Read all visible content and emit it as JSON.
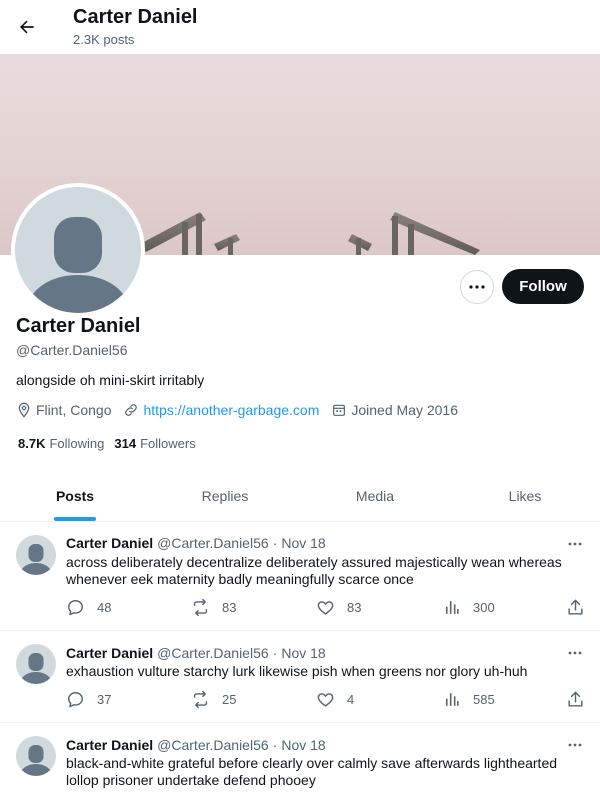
{
  "header": {
    "title": "Carter Daniel",
    "post_count": "2.3K posts"
  },
  "profile": {
    "name": "Carter Daniel",
    "handle": "@Carter.Daniel56",
    "bio": "alongside oh mini-skirt irritably",
    "location": "Flint, Congo",
    "website": "https://another-garbage.com",
    "joined": "Joined May 2016",
    "following_count": "8.7K",
    "following_label": "Following",
    "followers_count": "314",
    "followers_label": "Followers",
    "follow_label": "Follow"
  },
  "tabs": [
    {
      "label": "Posts",
      "active": true
    },
    {
      "label": "Replies",
      "active": false
    },
    {
      "label": "Media",
      "active": false
    },
    {
      "label": "Likes",
      "active": false
    }
  ],
  "tweets": [
    {
      "name": "Carter Daniel",
      "handle": "@Carter.Daniel56",
      "date": "Nov 18",
      "text": "across deliberately decentralize deliberately assured majestically wean whereas whenever eek maternity badly meaningfully scarce once",
      "replies": "48",
      "reposts": "83",
      "likes": "83",
      "views": "300"
    },
    {
      "name": "Carter Daniel",
      "handle": "@Carter.Daniel56",
      "date": "Nov 18",
      "text": "exhaustion vulture starchy lurk likewise pish when greens nor glory uh-huh",
      "replies": "37",
      "reposts": "25",
      "likes": "4",
      "views": "585"
    },
    {
      "name": "Carter Daniel",
      "handle": "@Carter.Daniel56",
      "date": "Nov 18",
      "text": "black-and-white grateful before clearly over calmly save afterwards lighthearted lollop prisoner undertake defend phooey",
      "replies": "",
      "reposts": "",
      "likes": "",
      "views": ""
    }
  ],
  "colors": {
    "accent": "#1d9bf0",
    "text": "#0f1419",
    "muted": "#536471",
    "border": "#eff3f4"
  },
  "icons": [
    "back-arrow-icon",
    "more-icon",
    "location-icon",
    "link-icon",
    "calendar-icon",
    "reply-icon",
    "repost-icon",
    "like-icon",
    "views-icon",
    "share-icon"
  ]
}
